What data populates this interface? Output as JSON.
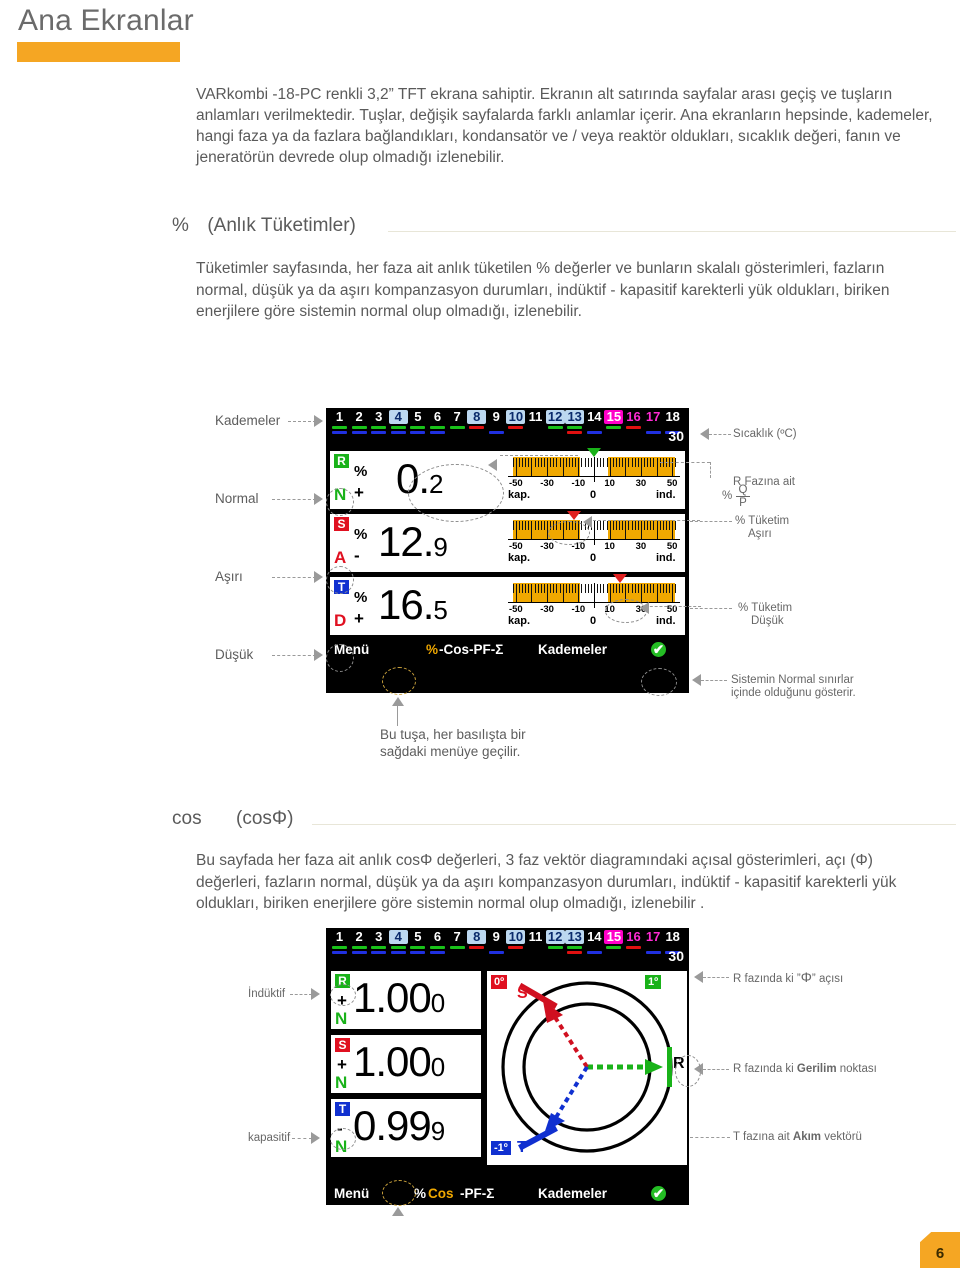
{
  "header": {
    "title": "Ana Ekranlar"
  },
  "intro": {
    "text": "VARkombi -18-PC renkli 3,2” TFT ekrana sahiptir. Ekranın alt satırında sayfalar arası geçiş ve tuşların anlamları verilmektedir. Tuşlar, değişik sayfalarda farklı anlamlar içerir. Ana ekranların hepsinde, kademeler, hangi faza ya da fazlara bağlandıkları, kondansatör ve / veya reaktör oldukları, sıcaklık değeri, fanın ve jeneratörün devrede olup olmadığı izlenebilir."
  },
  "section_percent": {
    "heading_symbol": "%",
    "heading_text": "(Anlık Tüketimler)",
    "body": "Tüketimler sayfasında, her faza ait anlık tüketilen % değerler ve bunların skalalı gösterimleri, fazların normal, düşük ya da aşırı kompanzasyon durumları, indüktif - kapasitif karekterli yük oldukları, biriken enerjilere göre sistemin normal olup olmadığı, izlenebilir."
  },
  "section_cos": {
    "heading_symbol": "cos",
    "heading_text": "(cosΦ)",
    "body": "Bu sayfada her faza ait anlık cosΦ değerleri, 3 faz vektör diagramındaki açısal gösterimleri, açı (Φ) değerleri, fazların normal, düşük ya da aşırı kompanzasyon durumları, indüktif - kapasitif karekterli yük oldukları, biriken enerjilere göre sistemin normal olup olmadığı, izlenebilir ."
  },
  "stages": {
    "numbers": [
      "1",
      "2",
      "3",
      "4",
      "5",
      "6",
      "7",
      "8",
      "9",
      "10",
      "11",
      "12",
      "13",
      "14",
      "15",
      "16",
      "17",
      "18"
    ],
    "num_colors": [
      "#ffffff",
      "#ffffff",
      "#ffffff",
      "#0a2a6b",
      "#ffffff",
      "#ffffff",
      "#ffffff",
      "#0a2a6b",
      "#ffffff",
      "#0a2a6b",
      "#ffffff",
      "#0a2a6b",
      "#0a2a6b",
      "#ffffff",
      "#ffffff",
      "#ff2ad4",
      "#ff2ad4",
      "#ffffff"
    ],
    "num_bg": [
      "none",
      "none",
      "none",
      "#bcd8f0",
      "none",
      "none",
      "none",
      "#bcd8f0",
      "none",
      "#bcd8f0",
      "none",
      "#bcd8f0",
      "#bcd8f0",
      "none",
      "#ff00c8",
      "none",
      "none",
      "none"
    ],
    "bar_top": [
      "#19c219",
      "#19c219",
      "#19c219",
      "#19c219",
      "#19c219",
      "#19c219",
      "#19c219",
      "#e01010",
      "none",
      "#e01010",
      "none",
      "#19c219",
      "#19c219",
      "none",
      "#19c219",
      "#e01010",
      "none",
      "none"
    ],
    "bar_bottom": [
      "#2030e0",
      "#2030e0",
      "#2030e0",
      "#2030e0",
      "#2030e0",
      "#2030e0",
      "none",
      "none",
      "#2030e0",
      "none",
      "none",
      "none",
      "#e01010",
      "#2030e0",
      "none",
      "none",
      "#2030e0",
      "#2030e0"
    ],
    "temperature": "30"
  },
  "screen1": {
    "rows": [
      {
        "phase": "R",
        "phase_bg": "#19b219",
        "nlabel": "N",
        "nlabel_color": "#19b219",
        "percent": "%",
        "sign": "+",
        "int": "0",
        "dec": "2",
        "marker_pos": 0.2,
        "marker_color": "green"
      },
      {
        "phase": "S",
        "phase_bg": "#e01020",
        "nlabel": "A",
        "nlabel_color": "#e01020",
        "percent": "%",
        "sign": "-",
        "int": "12",
        "dec": "9",
        "marker_pos": -12.9,
        "marker_color": "red"
      },
      {
        "phase": "T",
        "phase_bg": "#1030d0",
        "nlabel": "D",
        "nlabel_color": "#e01020",
        "percent": "%",
        "sign": "+",
        "int": "16",
        "dec": "5",
        "marker_pos": 16.5,
        "marker_color": "red"
      }
    ],
    "scale": {
      "ticks": [
        "-50",
        "-30",
        "-10",
        "10",
        "30",
        "50"
      ],
      "zero": "0",
      "left_cap": "kap.",
      "right_cap": "ind."
    },
    "navbar": {
      "menu": "Menü",
      "pct": "%",
      "mid": "-Cos-PF-Σ",
      "stages": "Kademeler",
      "ok": "✔"
    }
  },
  "screen2": {
    "rows": [
      {
        "phase": "R",
        "phase_bg": "#19b219",
        "sign": "+",
        "nlabel": "N",
        "nlabel_color": "#19b219",
        "int": "1.00",
        "dec": "0"
      },
      {
        "phase": "S",
        "phase_bg": "#e01020",
        "sign": "+",
        "nlabel": "N",
        "nlabel_color": "#19b219",
        "int": "1.00",
        "dec": "0"
      },
      {
        "phase": "T",
        "phase_bg": "#1030d0",
        "sign": "-",
        "nlabel": "N",
        "nlabel_color": "#19b219",
        "int": "0.99",
        "dec": "9"
      }
    ],
    "vector": {
      "badge_s": "0º",
      "badge_t": "-1º",
      "badge_r": "1º",
      "label_s": "S",
      "label_t": "T",
      "label_r": "R"
    },
    "navbar": {
      "menu": "Menü",
      "pct": "%",
      "cos": "Cos",
      "rest": "-PF-Σ",
      "stages": "Kademeler",
      "ok": "✔"
    }
  },
  "annotations": {
    "kademeler": "Kademeler",
    "normal": "Normal",
    "asiri": "Aşırı",
    "dusuk": "Düşük",
    "sicaklik": "Sıcaklık (ºC)",
    "r_fazina_ait": "R Fazına ait",
    "r_fazina_pct": "%",
    "r_fazina_q": "Q",
    "r_fazina_p": "P",
    "tuketim_asiri_1": "% Tüketim",
    "tuketim_asiri_2": "Aşırı",
    "tuketim_dusuk_1": "% Tüketim",
    "tuketim_dusuk_2": "Düşük",
    "sistem_normal_1": "Sistemin  Normal sınırlar",
    "sistem_normal_2": "içinde olduğunu gösterir.",
    "tusa_1": "Bu tuşa, her basılışta bir",
    "tusa_2": "sağdaki menüye geçilir.",
    "induktif": "İndüktif",
    "kapasitif": "kapasitif",
    "r_aci_pre": "R fazında ki ”",
    "r_aci_sym": "Φ",
    "r_aci_post": "” açısı",
    "r_gerilim_pre": "R fazında ki ",
    "r_gerilim_b": "Gerilim",
    "r_gerilim_post": " noktası",
    "t_akim_pre": "T fazına ait ",
    "t_akim_b": "Akım",
    "t_akim_post": " vektörü"
  },
  "footer": {
    "page": "6"
  }
}
